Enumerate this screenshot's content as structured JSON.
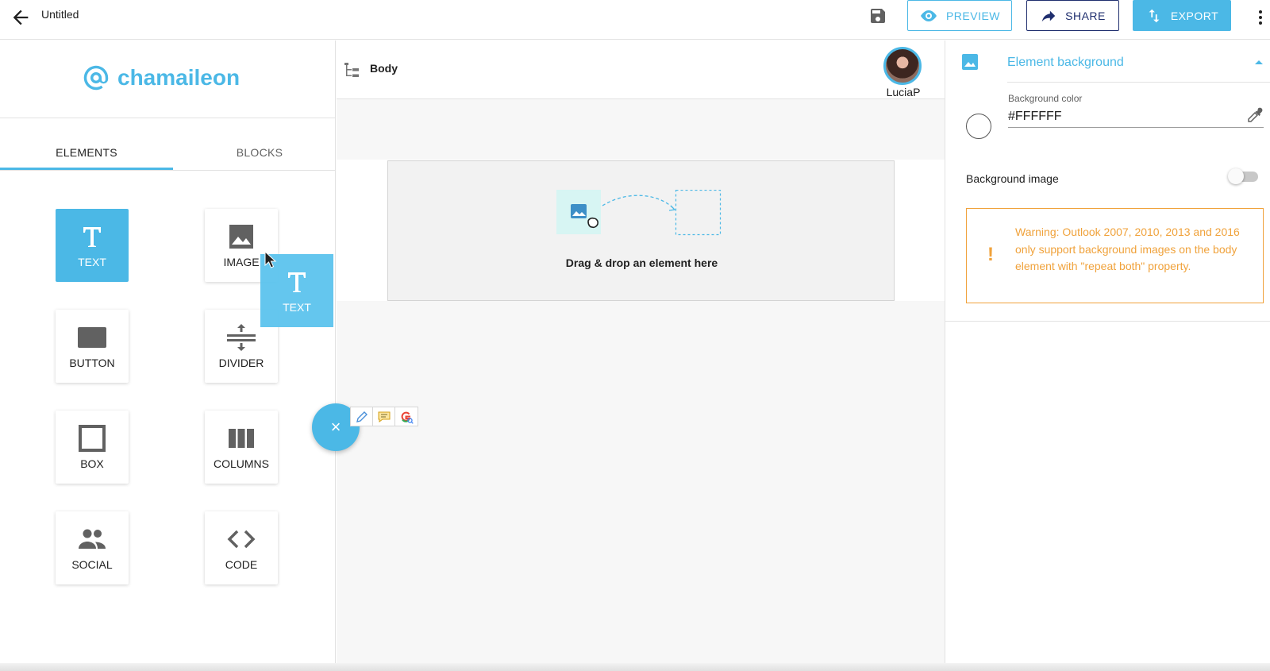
{
  "app": {
    "title": "Untitled",
    "accent_color": "#4bb8e6",
    "nav_color": "#1f2e6e",
    "warning_color": "#f0a23b"
  },
  "toolbar": {
    "back_icon": "arrow-left-icon",
    "save_icon": "floppy-disk-icon",
    "preview_label": "PREVIEW",
    "share_label": "SHARE",
    "export_label": "EXPORT",
    "more_icon": "more-vertical-icon"
  },
  "sidebar": {
    "logo_text": "chamaileon",
    "tabs": [
      {
        "label": "ELEMENTS",
        "active": true
      },
      {
        "label": "BLOCKS",
        "active": false
      }
    ],
    "elements": [
      {
        "label": "TEXT",
        "icon": "text-t-icon",
        "active": true
      },
      {
        "label": "IMAGE",
        "icon": "image-icon",
        "active": false
      },
      {
        "label": "BUTTON",
        "icon": "button-icon",
        "active": false
      },
      {
        "label": "DIVIDER",
        "icon": "divider-icon",
        "active": false
      },
      {
        "label": "BOX",
        "icon": "box-icon",
        "active": false
      },
      {
        "label": "COLUMNS",
        "icon": "columns-icon",
        "active": false
      },
      {
        "label": "SOCIAL",
        "icon": "social-people-icon",
        "active": false
      },
      {
        "label": "CODE",
        "icon": "code-icon",
        "active": false
      }
    ],
    "drag_ghost_label": "TEXT"
  },
  "fab": {
    "label": "×"
  },
  "canvas": {
    "breadcrumb_label": "Body",
    "user_name": "LuciaP",
    "dropzone_text": "Drag & drop an element here"
  },
  "right_panel": {
    "section_title": "Element background",
    "bg_color_label": "Background color",
    "bg_color_value": "#FFFFFF",
    "bg_image_label": "Background image",
    "bg_image_enabled": false,
    "warning_icon": "!",
    "warning_text": "Warning: Outlook 2007, 2010, 2013 and 2016 only support background images on the body element with \"repeat both\" property."
  }
}
